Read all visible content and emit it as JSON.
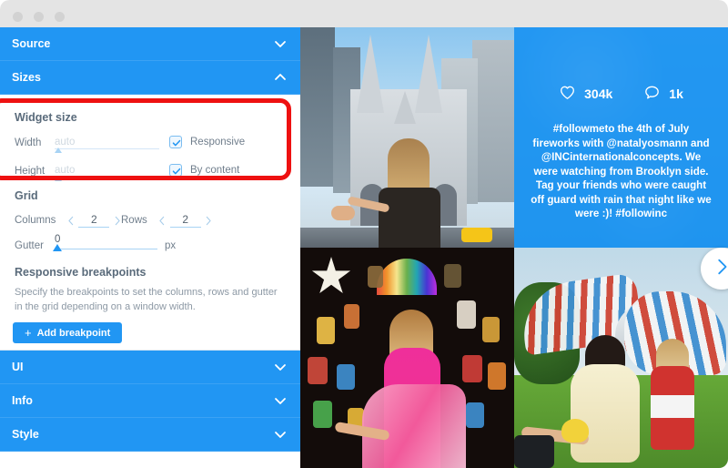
{
  "window": {
    "dots": [
      "close-dot",
      "minimize-dot",
      "maximize-dot"
    ]
  },
  "sidebar": {
    "sections": [
      {
        "label": "Source",
        "state": "collapsed",
        "icon": "chevron-down-icon"
      },
      {
        "label": "Sizes",
        "state": "expanded",
        "icon": "chevron-up-icon"
      },
      {
        "label": "UI",
        "state": "collapsed",
        "icon": "chevron-down-icon"
      },
      {
        "label": "Info",
        "state": "collapsed",
        "icon": "chevron-down-icon"
      },
      {
        "label": "Style",
        "state": "collapsed",
        "icon": "chevron-down-icon"
      }
    ]
  },
  "widget_size": {
    "title": "Widget size",
    "width": {
      "label": "Width",
      "value": "",
      "placeholder": "auto",
      "checkbox_label": "Responsive",
      "checked": true
    },
    "height": {
      "label": "Height",
      "value": "",
      "placeholder": "auto",
      "checkbox_label": "By content",
      "checked": true
    },
    "highlighted": true,
    "highlight_color": "#ee1111"
  },
  "grid": {
    "title": "Grid",
    "columns": {
      "label": "Columns",
      "value": "2",
      "prev_icon": "chevron-left-icon",
      "next_icon": "chevron-right-icon"
    },
    "rows": {
      "label": "Rows",
      "value": "2",
      "prev_icon": "chevron-left-icon",
      "next_icon": "chevron-right-icon"
    },
    "gutter": {
      "label": "Gutter",
      "value": "0",
      "unit": "px",
      "min": 0,
      "max": 100
    }
  },
  "breakpoints": {
    "title": "Responsive breakpoints",
    "description": "Specify the breakpoints to set the columns, rows and gutter in the grid depending on a window width.",
    "add_button": {
      "label": "Add breakpoint",
      "icon": "plus-icon"
    }
  },
  "gallery": {
    "tiles": [
      {
        "name": "cathedral-photo",
        "alt": "Woman leading by hand toward cathedral"
      },
      {
        "name": "instagram-post-overlay",
        "alt": "Fireworks photo with caption overlay"
      },
      {
        "name": "lantern-market-photo",
        "alt": "Woman in pink dress at lantern market"
      },
      {
        "name": "lawn-pavilion-photo",
        "alt": "Two women on lawn by colorful pavilion"
      }
    ],
    "post": {
      "likes": {
        "count": "304k",
        "icon": "heart-icon"
      },
      "comments": {
        "count": "1k",
        "icon": "comment-icon"
      },
      "caption": "#followmeto the 4th of July fireworks with @natalyosmann and @INCinternationalconcepts. We were watching from Brooklyn side. Tag your friends who were caught off guard with rain that night like we were :)! #followinc"
    },
    "next_button": {
      "icon": "chevron-right-icon"
    }
  },
  "colors": {
    "accent": "#2196f3",
    "highlight": "#ee1111",
    "titlebar": "#e4e4e4",
    "text_muted": "#707e8c"
  }
}
